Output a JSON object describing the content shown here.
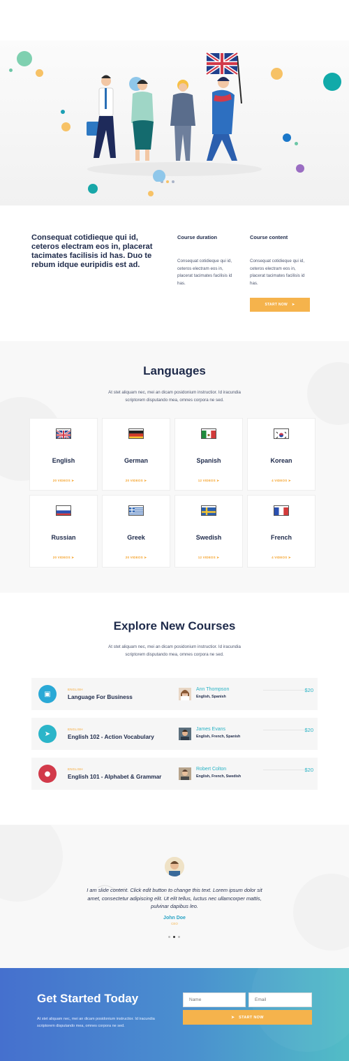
{
  "about": {
    "title": "Consequat cotidieque qui id, ceteros electram eos in, placerat tacimates facilisis id has. Duo te rebum idque euripidis est ad.",
    "col1": {
      "heading": "Course duration",
      "text": "Consequat cotidieque qui id, ceteros electram eos in, placerat tacimates facilisis id has."
    },
    "col2": {
      "heading": "Course content",
      "text": "Consequat cotidieque qui id, ceteros electram eos in, placerat tacimates facilisis id has."
    },
    "button": "START NOW"
  },
  "languages": {
    "title": "Languages",
    "subtitle": "At stet aliquam nec, mei an dicam posidonium instructior. Id iracundia scriptorem disputando mea, omnes corpora ne sed.",
    "cards": [
      {
        "name": "English",
        "videos": "20 VIDEOS",
        "flag": "uk-flag-icon"
      },
      {
        "name": "German",
        "videos": "20 VIDEOS",
        "flag": "germany-flag-icon"
      },
      {
        "name": "Spanish",
        "videos": "12 VIDEOS",
        "flag": "mexico-flag-icon"
      },
      {
        "name": "Korean",
        "videos": "4 VIDEOS",
        "flag": "korea-flag-icon"
      },
      {
        "name": "Russian",
        "videos": "20 VIDEOS",
        "flag": "russia-flag-icon"
      },
      {
        "name": "Greek",
        "videos": "20 VIDEOS",
        "flag": "greece-flag-icon"
      },
      {
        "name": "Swedish",
        "videos": "12 VIDEOS",
        "flag": "sweden-flag-icon"
      },
      {
        "name": "French",
        "videos": "4 VIDEOS",
        "flag": "france-flag-icon"
      }
    ]
  },
  "courses": {
    "title": "Explore New Courses",
    "subtitle": "At stet aliquam nec, mei an dicam posidonium instructior. Id iracundia scriptorem disputando mea, omnes corpora ne sed.",
    "items": [
      {
        "category": "ENGLISH",
        "name": "Language For Business",
        "teacher": "Ann Thompson",
        "languages": "English, Spanish",
        "price": "$20",
        "icon": "briefcase-icon",
        "color": "#2aa9d6"
      },
      {
        "category": "ENGLISH",
        "name": "English 102 - Action Vocabulary",
        "teacher": "James Evans",
        "languages": "English, French, Spanish",
        "price": "$20",
        "icon": "megaphone-icon",
        "color": "#2bb5c9"
      },
      {
        "category": "ENGLISH",
        "name": "English 101 - Alphabet & Grammar",
        "teacher": "Robert Colton",
        "languages": "English, French, Swedish",
        "price": "$20",
        "icon": "apple-icon",
        "color": "#d23a4a"
      }
    ]
  },
  "testimonial": {
    "quote": "I am slide content. Click edit button to change this text. Lorem ipsum dolor sit amet, consectetur adipiscing elit. Ut elit tellus, luctus nec ullamcorper mattis, pulvinar dapibus leo.",
    "name": "John Doe",
    "role": "CEO",
    "active_slide": 2,
    "slide_count": 3
  },
  "cta": {
    "title": "Get Started Today",
    "text": "At stet aliquam nec, mei an dicam posidonium instructior. Id iracundia scriptorem disputando mea, omnes corpora ne sed.",
    "name_placeholder": "Name",
    "email_placeholder": "Email",
    "button": "START NOW"
  },
  "colors": {
    "accent": "#f5b34c",
    "teal": "#29b3c5",
    "navy": "#1e2a4a"
  }
}
